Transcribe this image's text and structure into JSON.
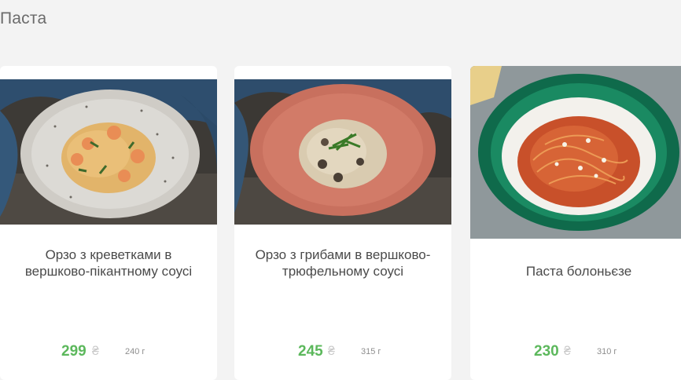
{
  "section": {
    "title": "Паста"
  },
  "products": [
    {
      "name": "Орзо з креветками в вершково-пікантному соусі",
      "price": "299",
      "currency": "₴",
      "weight": "240 г",
      "photo_icon": "orzo-shrimp-dish-photo"
    },
    {
      "name": "Орзо з грибами в вершково-трюфельному соусі",
      "price": "245",
      "currency": "₴",
      "weight": "315 г",
      "photo_icon": "orzo-mushroom-dish-photo"
    },
    {
      "name": "Паста болоньєзе",
      "price": "230",
      "currency": "₴",
      "weight": "310 г",
      "photo_icon": "pasta-bolognese-dish-photo"
    }
  ],
  "colors": {
    "price": "#5cb85c",
    "title": "#6b6b6b",
    "card_background": "#ffffff",
    "page_background": "#f3f3f3"
  }
}
